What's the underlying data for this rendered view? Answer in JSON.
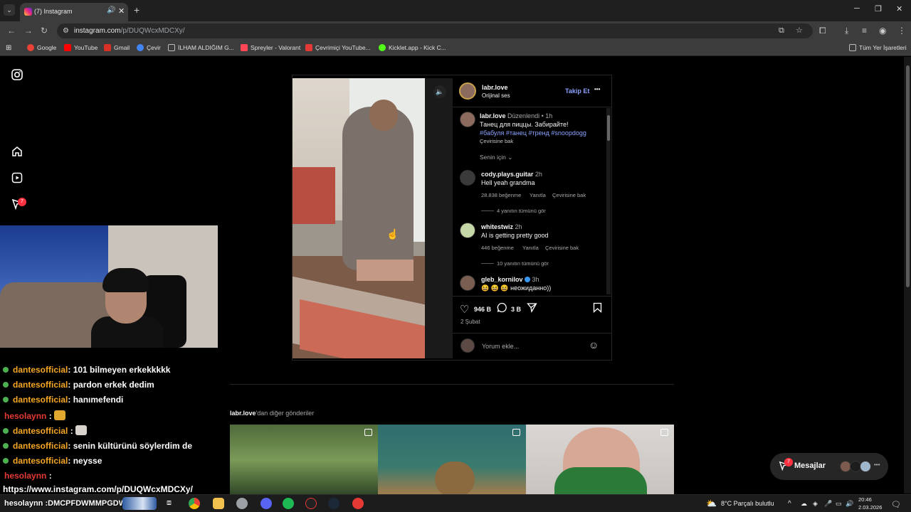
{
  "browser": {
    "tab_title": "(7) Instagram",
    "tab_audio": "🔊",
    "tab_close": "✕",
    "new_tab": "+",
    "tab_list": "⌄",
    "win_min": "─",
    "win_max": "❐",
    "win_close": "✕",
    "url_host": "instagram.com",
    "url_path": "/p/DUQWcxMDCXy/",
    "bookmarks": [
      {
        "label": "Google",
        "color": "#ea4335"
      },
      {
        "label": "YouTube",
        "color": "#ff0000"
      },
      {
        "label": "Gmail",
        "color": "#d93025"
      },
      {
        "label": "Çevir",
        "color": "#4285f4"
      },
      {
        "label": "İLHAM ALDIĞIM G...",
        "color": "#9aa0a6"
      },
      {
        "label": "Spreyler - Valorant",
        "color": "#ff4655"
      },
      {
        "label": "Çevrimiçi YouTube...",
        "color": "#e53935"
      },
      {
        "label": "Kicklet.app - Kick C...",
        "color": "#53fc18"
      }
    ],
    "all_bookmarks": "Tüm Yer İşaretleri"
  },
  "sidebar": {
    "notifications_badge": "7"
  },
  "chat": [
    {
      "user": "dantesofficial",
      "text": ": 101 bilmeyen erkekkkkk",
      "color": "#f5a623",
      "emote": false
    },
    {
      "user": "dantesofficial",
      "text": ": pardon erkek dedim",
      "color": "#f5a623",
      "emote": false
    },
    {
      "user": "dantesofficial",
      "text": ": hanımefendi",
      "color": "#f5a623",
      "emote": false
    },
    {
      "user": "hesolaynn",
      "text": " :",
      "color": "#e53935",
      "emote": true
    },
    {
      "user": "dantesofficial",
      "text": " :",
      "color": "#f5a623",
      "emote": true
    },
    {
      "user": "dantesofficial",
      "text": ": senin kültürünü söylerdim de",
      "color": "#f5a623",
      "emote": false
    },
    {
      "user": "dantesofficial",
      "text": ": neysse",
      "color": "#f5a623",
      "emote": false
    },
    {
      "user": "hesolaynn",
      "text": " :",
      "color": "#e53935",
      "emote": false
    }
  ],
  "chat_link": "https://www.instagram.com/p/DUQWcxMDCXy/",
  "chat_bottom": "hesolaynn :DMCPFDWMMPGDWG",
  "post": {
    "username": "labr.love",
    "audio": "Orijinal ses",
    "follow": "Takip Et",
    "more": "•••",
    "caption_user": "labr.love",
    "caption_edited": "Düzenlendi",
    "caption_time": "1h",
    "caption_text": "Танец для пиццы. Забирайте!",
    "caption_tags": "#бабуля #танец #тренд #snoopdogg",
    "see_translation": "Çevirisine bak",
    "for_you": "Senin için ⌄",
    "comments": [
      {
        "user": "cody.plays.guitar",
        "time": "2h",
        "text": "Hell yeah grandma",
        "likes": "28.838 beğenme",
        "reply": "Yanıtla",
        "translate": "Çevirisine bak",
        "replies": "4 yanıtın tümünü gör",
        "verified": false
      },
      {
        "user": "whitestwiz",
        "time": "2h",
        "text": "AI is getting pretty good",
        "likes": "446 beğenme",
        "reply": "Yanıtla",
        "translate": "Çevirisine bak",
        "replies": "10 yanıtın tümünü gör",
        "verified": false
      },
      {
        "user": "gleb_kornilov",
        "time": "3h",
        "text": "😆 😆 😆 неожиданно))",
        "verified": true
      }
    ],
    "likes": "946 B",
    "comments_count": "3 B",
    "date": "2 Şubat",
    "comment_placeholder": "Yorum ekle...",
    "video_progress": 0.52
  },
  "more_posts_user": "labr.love",
  "more_posts_suffix": "'dan diğer gönderiler",
  "messages": {
    "label": "Mesajlar",
    "badge": "7"
  },
  "taskbar": {
    "weather": "8°C  Parçalı bulutlu",
    "time": "20:46",
    "date": "2.03.2026"
  }
}
